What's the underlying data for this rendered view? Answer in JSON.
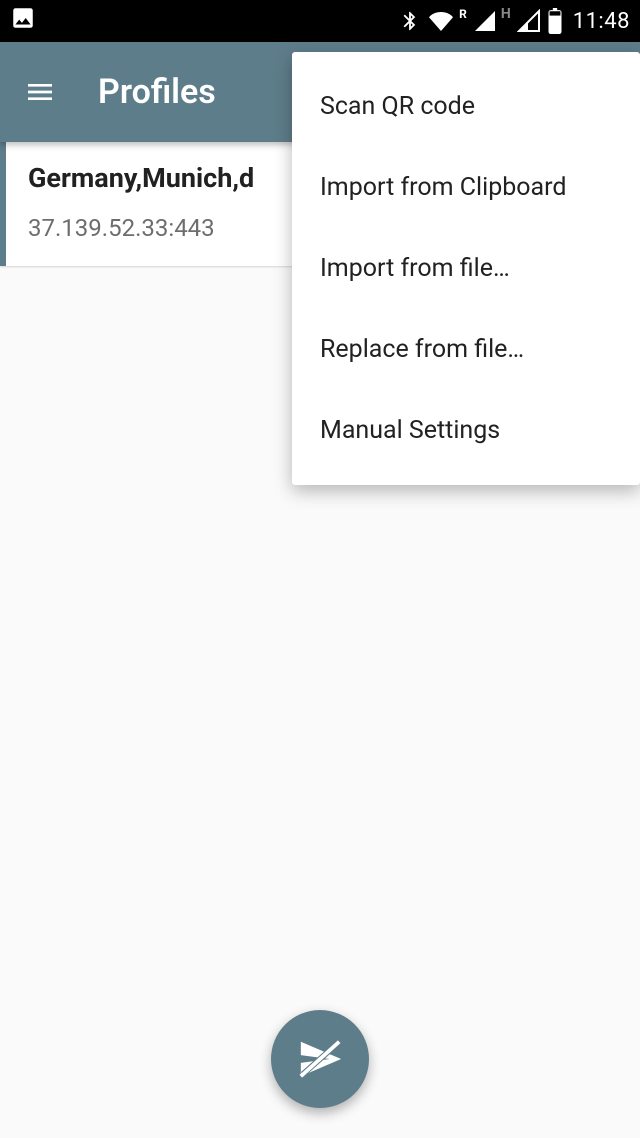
{
  "status": {
    "time": "11:48"
  },
  "appbar": {
    "title": "Profiles"
  },
  "profile": {
    "name": "Germany,Munich,d",
    "address": "37.139.52.33:443"
  },
  "menu": {
    "items": [
      {
        "label": "Scan QR code"
      },
      {
        "label": "Import from Clipboard"
      },
      {
        "label": "Import from file…"
      },
      {
        "label": "Replace from file…"
      },
      {
        "label": "Manual Settings"
      }
    ]
  }
}
